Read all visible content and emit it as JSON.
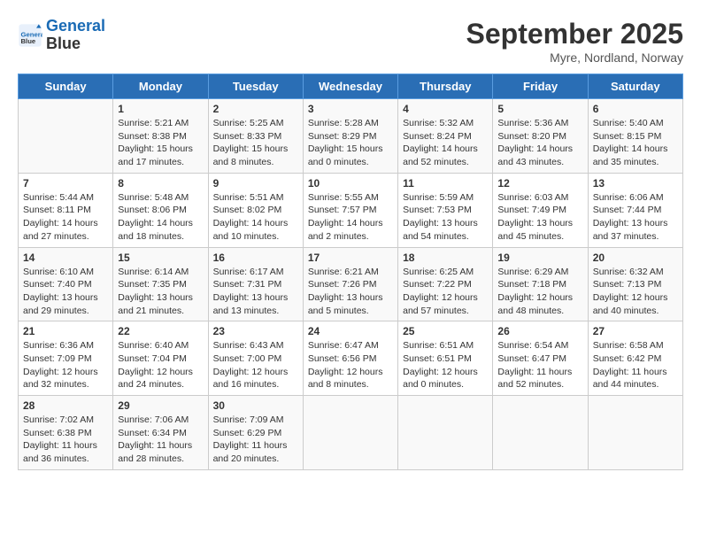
{
  "header": {
    "logo_line1": "General",
    "logo_line2": "Blue",
    "month": "September 2025",
    "location": "Myre, Nordland, Norway"
  },
  "weekdays": [
    "Sunday",
    "Monday",
    "Tuesday",
    "Wednesday",
    "Thursday",
    "Friday",
    "Saturday"
  ],
  "weeks": [
    [
      {
        "day": "",
        "info": ""
      },
      {
        "day": "1",
        "info": "Sunrise: 5:21 AM\nSunset: 8:38 PM\nDaylight: 15 hours\nand 17 minutes."
      },
      {
        "day": "2",
        "info": "Sunrise: 5:25 AM\nSunset: 8:33 PM\nDaylight: 15 hours\nand 8 minutes."
      },
      {
        "day": "3",
        "info": "Sunrise: 5:28 AM\nSunset: 8:29 PM\nDaylight: 15 hours\nand 0 minutes."
      },
      {
        "day": "4",
        "info": "Sunrise: 5:32 AM\nSunset: 8:24 PM\nDaylight: 14 hours\nand 52 minutes."
      },
      {
        "day": "5",
        "info": "Sunrise: 5:36 AM\nSunset: 8:20 PM\nDaylight: 14 hours\nand 43 minutes."
      },
      {
        "day": "6",
        "info": "Sunrise: 5:40 AM\nSunset: 8:15 PM\nDaylight: 14 hours\nand 35 minutes."
      }
    ],
    [
      {
        "day": "7",
        "info": "Sunrise: 5:44 AM\nSunset: 8:11 PM\nDaylight: 14 hours\nand 27 minutes."
      },
      {
        "day": "8",
        "info": "Sunrise: 5:48 AM\nSunset: 8:06 PM\nDaylight: 14 hours\nand 18 minutes."
      },
      {
        "day": "9",
        "info": "Sunrise: 5:51 AM\nSunset: 8:02 PM\nDaylight: 14 hours\nand 10 minutes."
      },
      {
        "day": "10",
        "info": "Sunrise: 5:55 AM\nSunset: 7:57 PM\nDaylight: 14 hours\nand 2 minutes."
      },
      {
        "day": "11",
        "info": "Sunrise: 5:59 AM\nSunset: 7:53 PM\nDaylight: 13 hours\nand 54 minutes."
      },
      {
        "day": "12",
        "info": "Sunrise: 6:03 AM\nSunset: 7:49 PM\nDaylight: 13 hours\nand 45 minutes."
      },
      {
        "day": "13",
        "info": "Sunrise: 6:06 AM\nSunset: 7:44 PM\nDaylight: 13 hours\nand 37 minutes."
      }
    ],
    [
      {
        "day": "14",
        "info": "Sunrise: 6:10 AM\nSunset: 7:40 PM\nDaylight: 13 hours\nand 29 minutes."
      },
      {
        "day": "15",
        "info": "Sunrise: 6:14 AM\nSunset: 7:35 PM\nDaylight: 13 hours\nand 21 minutes."
      },
      {
        "day": "16",
        "info": "Sunrise: 6:17 AM\nSunset: 7:31 PM\nDaylight: 13 hours\nand 13 minutes."
      },
      {
        "day": "17",
        "info": "Sunrise: 6:21 AM\nSunset: 7:26 PM\nDaylight: 13 hours\nand 5 minutes."
      },
      {
        "day": "18",
        "info": "Sunrise: 6:25 AM\nSunset: 7:22 PM\nDaylight: 12 hours\nand 57 minutes."
      },
      {
        "day": "19",
        "info": "Sunrise: 6:29 AM\nSunset: 7:18 PM\nDaylight: 12 hours\nand 48 minutes."
      },
      {
        "day": "20",
        "info": "Sunrise: 6:32 AM\nSunset: 7:13 PM\nDaylight: 12 hours\nand 40 minutes."
      }
    ],
    [
      {
        "day": "21",
        "info": "Sunrise: 6:36 AM\nSunset: 7:09 PM\nDaylight: 12 hours\nand 32 minutes."
      },
      {
        "day": "22",
        "info": "Sunrise: 6:40 AM\nSunset: 7:04 PM\nDaylight: 12 hours\nand 24 minutes."
      },
      {
        "day": "23",
        "info": "Sunrise: 6:43 AM\nSunset: 7:00 PM\nDaylight: 12 hours\nand 16 minutes."
      },
      {
        "day": "24",
        "info": "Sunrise: 6:47 AM\nSunset: 6:56 PM\nDaylight: 12 hours\nand 8 minutes."
      },
      {
        "day": "25",
        "info": "Sunrise: 6:51 AM\nSunset: 6:51 PM\nDaylight: 12 hours\nand 0 minutes."
      },
      {
        "day": "26",
        "info": "Sunrise: 6:54 AM\nSunset: 6:47 PM\nDaylight: 11 hours\nand 52 minutes."
      },
      {
        "day": "27",
        "info": "Sunrise: 6:58 AM\nSunset: 6:42 PM\nDaylight: 11 hours\nand 44 minutes."
      }
    ],
    [
      {
        "day": "28",
        "info": "Sunrise: 7:02 AM\nSunset: 6:38 PM\nDaylight: 11 hours\nand 36 minutes."
      },
      {
        "day": "29",
        "info": "Sunrise: 7:06 AM\nSunset: 6:34 PM\nDaylight: 11 hours\nand 28 minutes."
      },
      {
        "day": "30",
        "info": "Sunrise: 7:09 AM\nSunset: 6:29 PM\nDaylight: 11 hours\nand 20 minutes."
      },
      {
        "day": "",
        "info": ""
      },
      {
        "day": "",
        "info": ""
      },
      {
        "day": "",
        "info": ""
      },
      {
        "day": "",
        "info": ""
      }
    ]
  ]
}
